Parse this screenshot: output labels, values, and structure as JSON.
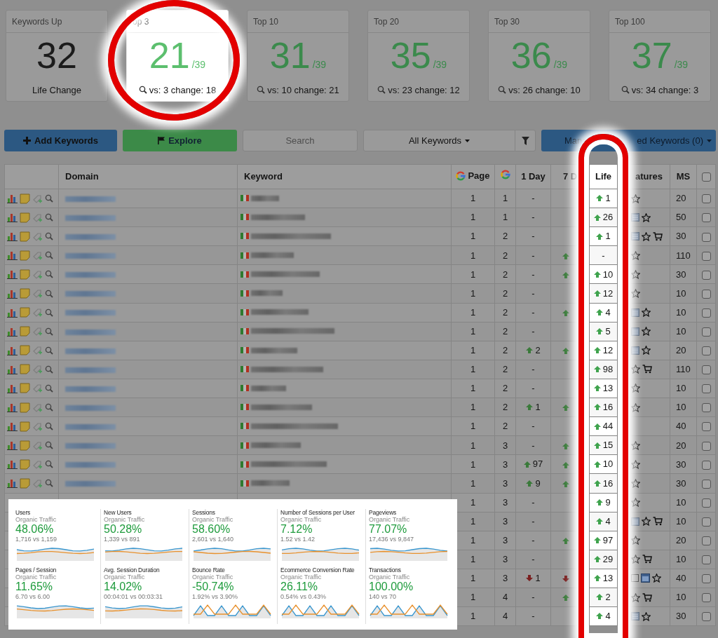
{
  "cards": [
    {
      "kind": "count",
      "label": "Keywords Up",
      "value": "32",
      "caption": "Life Change",
      "highlighted": false
    },
    {
      "kind": "ratio",
      "label": "op 3",
      "value": "21",
      "total": "/39",
      "vs": "vs: 3 change: 18",
      "highlighted": true
    },
    {
      "kind": "ratio",
      "label": "Top 10",
      "value": "31",
      "total": "/39",
      "vs": "vs: 10 change: 21",
      "highlighted": false
    },
    {
      "kind": "ratio",
      "label": "Top 20",
      "value": "35",
      "total": "/39",
      "vs": "vs: 23 change: 12",
      "highlighted": false
    },
    {
      "kind": "ratio",
      "label": "Top 30",
      "value": "36",
      "total": "/39",
      "vs": "vs: 26 change: 10",
      "highlighted": false
    },
    {
      "kind": "ratio",
      "label": "Top 100",
      "value": "37",
      "total": "/39",
      "vs": "vs: 34 change: 3",
      "highlighted": false
    }
  ],
  "toolbar": {
    "add_button": "Add Keywords",
    "explore_button": "Explore",
    "search": {
      "placeholder": "Search"
    },
    "filter_dropdown": "All Keywords",
    "manage_button": {
      "label_start": "Mana",
      "label_end": "ed Keywords (0)"
    }
  },
  "columns": [
    {
      "kind": "actions",
      "highlighted": false
    },
    {
      "kind": "text",
      "label": "Domain",
      "highlighted": false
    },
    {
      "kind": "text",
      "label": "Keyword",
      "highlighted": false
    },
    {
      "kind": "google",
      "label": "Page",
      "highlighted": false
    },
    {
      "kind": "google",
      "highlighted": false
    },
    {
      "kind": "text",
      "label": "1 Day",
      "highlighted": false
    },
    {
      "kind": "text",
      "label": "7 D",
      "highlighted": false
    },
    {
      "kind": "text",
      "label": "Life",
      "highlighted": true
    },
    {
      "kind": "spacer",
      "highlighted": false
    },
    {
      "kind": "text",
      "label": "atures",
      "highlighted": false
    },
    {
      "kind": "text",
      "label": "MS",
      "highlighted": false
    },
    {
      "kind": "checkbox",
      "checked": false,
      "highlighted": false
    }
  ],
  "rows": [
    {
      "kind": "full",
      "page": "1",
      "g": "1",
      "day1": {
        "kind": "none",
        "value": "-"
      },
      "day7": {
        "kind": "none"
      },
      "life": {
        "kind": "up",
        "value": "1"
      },
      "features": [
        {
          "kind": "star"
        }
      ],
      "ms": "20",
      "checked": false
    },
    {
      "kind": "full",
      "page": "1",
      "g": "1",
      "day1": {
        "kind": "none",
        "value": "-"
      },
      "day7": {
        "kind": "none"
      },
      "life": {
        "kind": "up",
        "value": "26"
      },
      "features": [
        {
          "kind": "list"
        },
        {
          "kind": "star"
        }
      ],
      "ms": "50",
      "checked": false
    },
    {
      "kind": "full",
      "page": "1",
      "g": "2",
      "day1": {
        "kind": "none",
        "value": "-"
      },
      "day7": {
        "kind": "none"
      },
      "life": {
        "kind": "up",
        "value": "1"
      },
      "features": [
        {
          "kind": "list"
        },
        {
          "kind": "star"
        },
        {
          "kind": "cart"
        }
      ],
      "ms": "30",
      "checked": false
    },
    {
      "kind": "full",
      "page": "1",
      "g": "2",
      "day1": {
        "kind": "none",
        "value": "-"
      },
      "day7": {
        "kind": "up"
      },
      "life": {
        "kind": "none",
        "value": "-"
      },
      "features": [
        {
          "kind": "star"
        }
      ],
      "ms": "110",
      "checked": false
    },
    {
      "kind": "full",
      "page": "1",
      "g": "2",
      "day1": {
        "kind": "none",
        "value": "-"
      },
      "day7": {
        "kind": "up"
      },
      "life": {
        "kind": "up",
        "value": "10"
      },
      "features": [
        {
          "kind": "star"
        }
      ],
      "ms": "30",
      "checked": false
    },
    {
      "kind": "full",
      "page": "1",
      "g": "2",
      "day1": {
        "kind": "none",
        "value": "-"
      },
      "day7": {
        "kind": "none"
      },
      "life": {
        "kind": "up",
        "value": "12"
      },
      "features": [
        {
          "kind": "star"
        }
      ],
      "ms": "10",
      "checked": false
    },
    {
      "kind": "full",
      "page": "1",
      "g": "2",
      "day1": {
        "kind": "none",
        "value": "-"
      },
      "day7": {
        "kind": "up"
      },
      "life": {
        "kind": "up",
        "value": "4"
      },
      "features": [
        {
          "kind": "list"
        },
        {
          "kind": "star"
        }
      ],
      "ms": "10",
      "checked": false
    },
    {
      "kind": "full",
      "page": "1",
      "g": "2",
      "day1": {
        "kind": "none",
        "value": "-"
      },
      "day7": {
        "kind": "none"
      },
      "life": {
        "kind": "up",
        "value": "5"
      },
      "features": [
        {
          "kind": "list"
        },
        {
          "kind": "star"
        }
      ],
      "ms": "10",
      "checked": false
    },
    {
      "kind": "full",
      "page": "1",
      "g": "2",
      "day1": {
        "kind": "up",
        "value": "2"
      },
      "day7": {
        "kind": "up"
      },
      "life": {
        "kind": "up",
        "value": "12"
      },
      "features": [
        {
          "kind": "list"
        },
        {
          "kind": "star"
        }
      ],
      "ms": "20",
      "checked": false
    },
    {
      "kind": "full",
      "page": "1",
      "g": "2",
      "day1": {
        "kind": "none",
        "value": "-"
      },
      "day7": {
        "kind": "none"
      },
      "life": {
        "kind": "up",
        "value": "98"
      },
      "features": [
        {
          "kind": "star"
        },
        {
          "kind": "cart"
        }
      ],
      "ms": "110",
      "checked": false
    },
    {
      "kind": "full",
      "page": "1",
      "g": "2",
      "day1": {
        "kind": "none",
        "value": "-"
      },
      "day7": {
        "kind": "none"
      },
      "life": {
        "kind": "up",
        "value": "13"
      },
      "features": [
        {
          "kind": "star"
        }
      ],
      "ms": "10",
      "checked": false
    },
    {
      "kind": "full",
      "page": "1",
      "g": "2",
      "day1": {
        "kind": "up",
        "value": "1"
      },
      "day7": {
        "kind": "up"
      },
      "life": {
        "kind": "up",
        "value": "16"
      },
      "features": [
        {
          "kind": "star"
        }
      ],
      "ms": "10",
      "checked": false
    },
    {
      "kind": "full",
      "page": "1",
      "g": "2",
      "day1": {
        "kind": "none",
        "value": "-"
      },
      "day7": {
        "kind": "none"
      },
      "life": {
        "kind": "up",
        "value": "44"
      },
      "ms": "40",
      "checked": false
    },
    {
      "kind": "full",
      "page": "1",
      "g": "3",
      "day1": {
        "kind": "none",
        "value": "-"
      },
      "day7": {
        "kind": "up"
      },
      "life": {
        "kind": "up",
        "value": "15"
      },
      "features": [
        {
          "kind": "star"
        }
      ],
      "ms": "20",
      "checked": false
    },
    {
      "kind": "full",
      "page": "1",
      "g": "3",
      "day1": {
        "kind": "up",
        "value": "97"
      },
      "day7": {
        "kind": "up"
      },
      "life": {
        "kind": "up",
        "value": "10"
      },
      "features": [
        {
          "kind": "star"
        }
      ],
      "ms": "30",
      "checked": false
    },
    {
      "kind": "full",
      "page": "1",
      "g": "3",
      "day1": {
        "kind": "up",
        "value": "9"
      },
      "day7": {
        "kind": "up"
      },
      "life": {
        "kind": "up",
        "value": "16"
      },
      "features": [
        {
          "kind": "star"
        }
      ],
      "ms": "30",
      "checked": false
    },
    {
      "kind": "partial",
      "page": "1",
      "g": "3",
      "day1": {
        "kind": "none",
        "value": "-"
      },
      "day7": {
        "kind": "none"
      },
      "life": {
        "kind": "up",
        "value": "9"
      },
      "features": [
        {
          "kind": "star"
        }
      ],
      "ms": "10",
      "checked": false
    },
    {
      "kind": "partial",
      "page": "1",
      "g": "3",
      "day1": {
        "kind": "none",
        "value": "-"
      },
      "day7": {
        "kind": "none"
      },
      "life": {
        "kind": "up",
        "value": "4"
      },
      "features": [
        {
          "kind": "list"
        },
        {
          "kind": "star"
        },
        {
          "kind": "cart"
        }
      ],
      "ms": "10",
      "checked": false
    },
    {
      "kind": "partial",
      "page": "1",
      "g": "3",
      "day1": {
        "kind": "none",
        "value": "-"
      },
      "day7": {
        "kind": "up"
      },
      "life": {
        "kind": "up",
        "value": "97"
      },
      "features": [
        {
          "kind": "star"
        }
      ],
      "ms": "20",
      "checked": false
    },
    {
      "kind": "partial",
      "page": "1",
      "g": "3",
      "day1": {
        "kind": "none",
        "value": "-"
      },
      "day7": {
        "kind": "none"
      },
      "life": {
        "kind": "up",
        "value": "29"
      },
      "features": [
        {
          "kind": "star"
        },
        {
          "kind": "cart"
        }
      ],
      "ms": "10",
      "checked": false
    },
    {
      "kind": "partial",
      "page": "1",
      "g": "3",
      "day1": {
        "kind": "down",
        "value": "1"
      },
      "day7": {
        "kind": "down"
      },
      "life": {
        "kind": "up",
        "value": "13"
      },
      "features": [
        {
          "kind": "square"
        },
        {
          "kind": "calendar"
        },
        {
          "kind": "star"
        }
      ],
      "ms": "40",
      "checked": false
    },
    {
      "kind": "partial",
      "page": "1",
      "g": "4",
      "day1": {
        "kind": "none",
        "value": "-"
      },
      "day7": {
        "kind": "up"
      },
      "life": {
        "kind": "up",
        "value": "2"
      },
      "features": [
        {
          "kind": "star"
        },
        {
          "kind": "cart"
        }
      ],
      "ms": "10",
      "checked": false
    },
    {
      "kind": "partial",
      "page": "1",
      "g": "4",
      "day1": {
        "kind": "none",
        "value": "-"
      },
      "day7": {
        "kind": "none"
      },
      "life": {
        "kind": "up",
        "value": "4"
      },
      "features": [
        {
          "kind": "list"
        },
        {
          "kind": "star"
        }
      ],
      "ms": "30",
      "checked": false
    }
  ],
  "analytics": [
    {
      "title": "Users",
      "subtitle": "Organic Traffic",
      "value": "48.06%",
      "comparison": "1,716 vs 1,159"
    },
    {
      "title": "New Users",
      "subtitle": "Organic Traffic",
      "value": "50.28%",
      "comparison": "1,339 vs 891"
    },
    {
      "title": "Sessions",
      "subtitle": "Organic Traffic",
      "value": "58.60%",
      "comparison": "2,601 vs 1,640"
    },
    {
      "title": "Number of Sessions per User",
      "subtitle": "Organic Traffic",
      "value": "7.12%",
      "comparison": "1.52 vs 1.42"
    },
    {
      "title": "Pageviews",
      "subtitle": "Organic Traffic",
      "value": "77.07%",
      "comparison": "17,436 vs 9,847"
    },
    {
      "title": "Pages / Session",
      "subtitle": "Organic Traffic",
      "value": "11.65%",
      "comparison": "6.70 vs 6.00"
    },
    {
      "title": "Avg. Session Duration",
      "subtitle": "Organic Traffic",
      "value": "14.02%",
      "comparison": "00:04:01 vs 00:03:31"
    },
    {
      "title": "Bounce Rate",
      "subtitle": "Organic Traffic",
      "value": "-50.74%",
      "comparison": "1.92% vs 3.90%"
    },
    {
      "title": "Ecommerce Conversion Rate",
      "subtitle": "Organic Traffic",
      "value": "26.11%",
      "comparison": "0.54% vs 0.43%"
    },
    {
      "title": "Transactions",
      "subtitle": "Organic Traffic",
      "value": "100.00%",
      "comparison": "140 vs 70"
    }
  ]
}
